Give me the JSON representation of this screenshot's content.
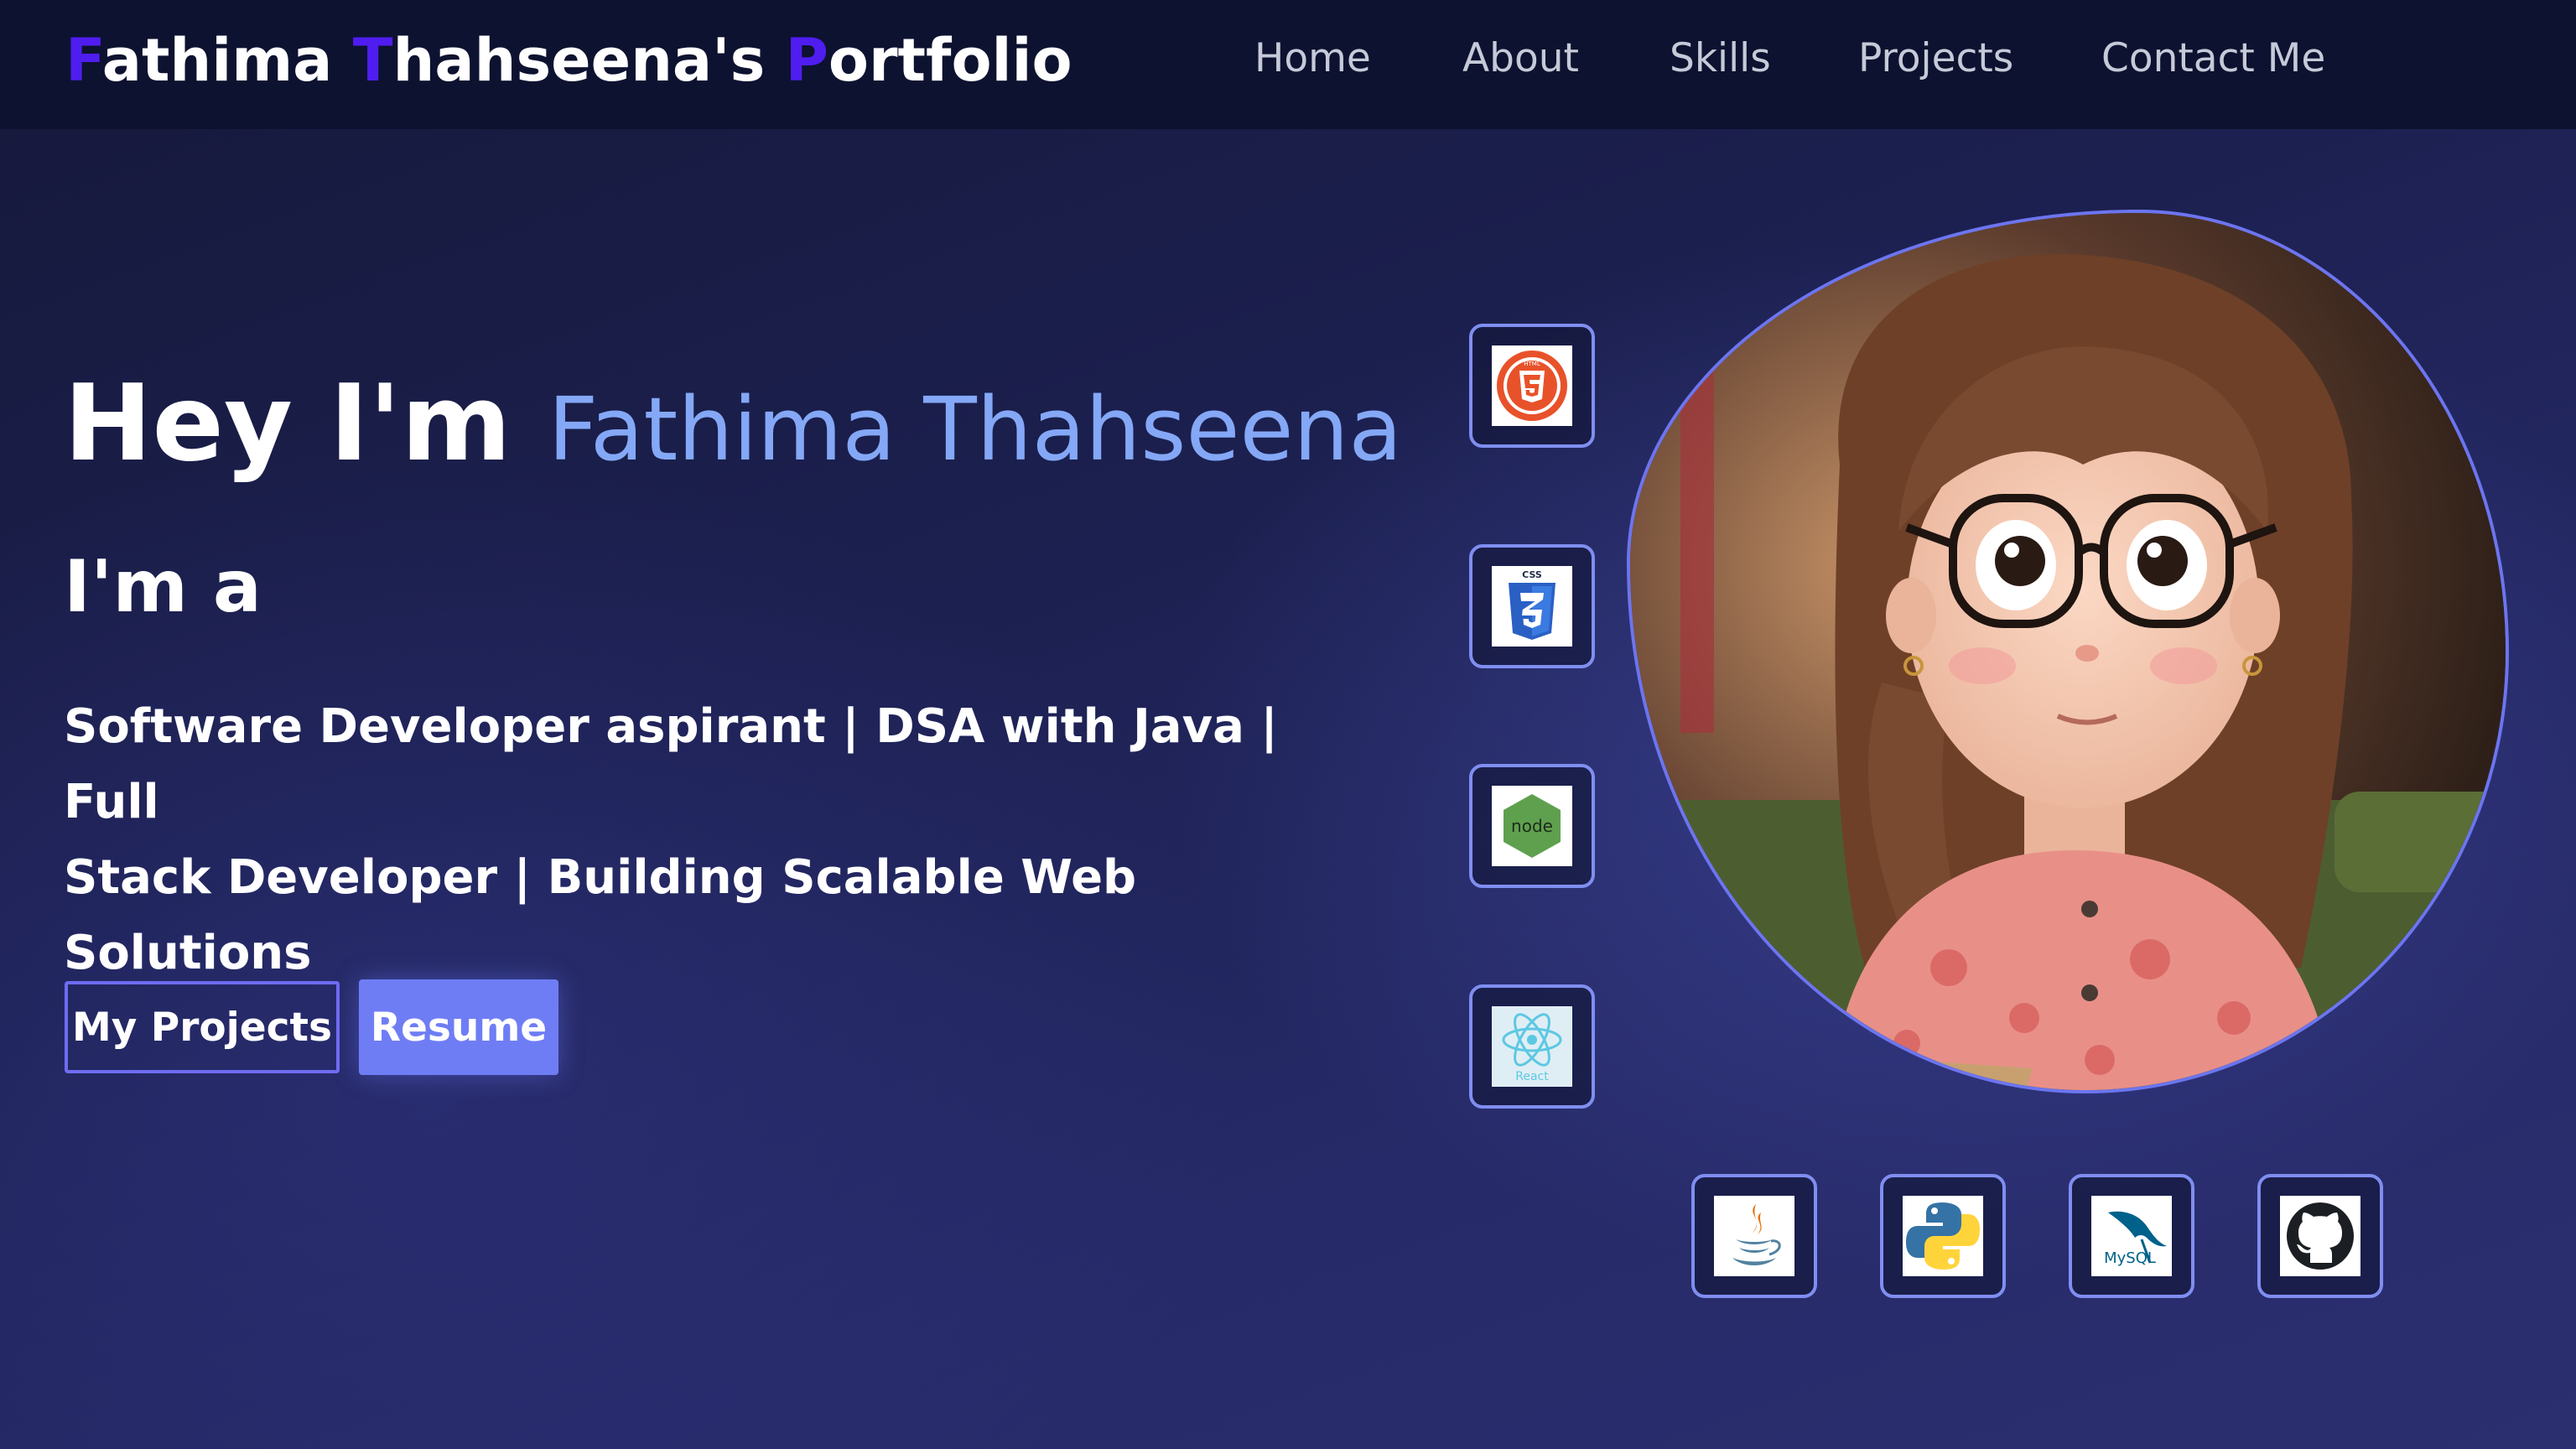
{
  "nav": {
    "brand_parts": [
      "F",
      "athima ",
      "T",
      "hahseena's ",
      "P",
      "ortfolio"
    ],
    "links": [
      "Home",
      "About",
      "Skills",
      "Projects",
      "Contact Me"
    ]
  },
  "hero": {
    "greeting": "Hey I'm",
    "name": "Fathima Thahseena",
    "subtitle": "I'm a",
    "description_line1": "Software Developer aspirant | DSA with Java | Full",
    "description_line2": "Stack Developer | Building Scalable Web Solutions",
    "btn_projects": "My Projects",
    "btn_resume": "Resume"
  },
  "skill_icons": {
    "side": [
      "html5-icon",
      "css3-icon",
      "nodejs-icon",
      "react-icon"
    ],
    "bottom": [
      "java-icon",
      "python-icon",
      "mysql-icon",
      "github-icon"
    ],
    "labels": {
      "html": "HTML",
      "css": "CSS",
      "node": "node",
      "react": "React",
      "mysql": "MySQL"
    }
  },
  "colors": {
    "brand_accent": "#4f1df0",
    "name_color": "#84a8f6",
    "button_fill": "#6f7df5",
    "tile_border": "#7f8ef0"
  }
}
